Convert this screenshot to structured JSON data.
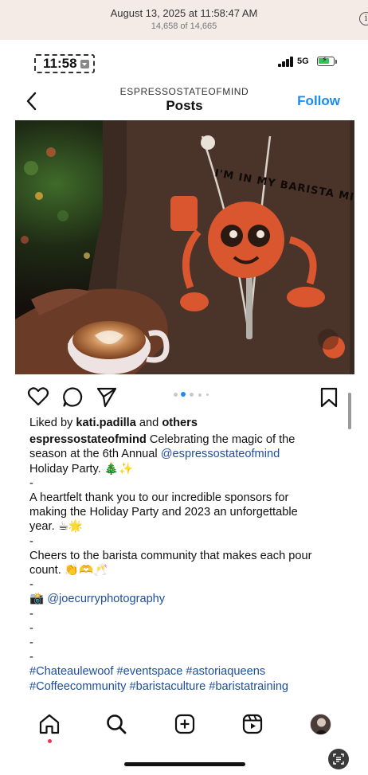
{
  "viewer": {
    "date": "August 13, 2025 at 11:58:47 AM",
    "count": "14,658 of 14,665",
    "info_icon": "info-icon"
  },
  "status_bar": {
    "time": "11:58",
    "network": "5G",
    "battery_icon": "battery-charging-icon",
    "battery_color": "#39c25a"
  },
  "header": {
    "account": "ESPRESSOSTATEOFMIND",
    "title": "Posts",
    "follow_label": "Follow",
    "follow_color": "#1a8cf0"
  },
  "post": {
    "carousel_dots": 5,
    "active_dot": 1,
    "liked_prefix": "Liked by ",
    "liked_user": "kati.padilla",
    "liked_mid": " and ",
    "liked_suffix": "others",
    "caption": {
      "username": "espressostateofmind",
      "l1_text": " Celebrating the magic of the",
      "l2_text": "season at the 6th Annual ",
      "l2_mention": "@espressostateofmind",
      "l3_text": "Holiday Party. 🎄✨",
      "dash": "-",
      "l5": "A heartfelt thank you to our incredible sponsors for",
      "l6": "making the Holiday Party and 2023 an unforgettable",
      "l7": "year. ☕🌟",
      "l9": "Cheers to the barista community that makes each pour",
      "l10": "count. 👏🫶🥂",
      "l12_icon": "📸",
      "l12_mention": "@joecurryphotography",
      "h1": "#Chateaulewoof",
      "h2": "#eventspace",
      "h3": "#astoriaqueens",
      "h4": "#Coffeecommunity",
      "h5": "#baristaculture",
      "h6": "#baristatraining"
    },
    "shirt_text": "I'M IN MY BARISTA MILK ERA"
  },
  "nav": {
    "items": [
      "home-icon",
      "search-icon",
      "create-icon",
      "reels-icon",
      "profile-avatar"
    ],
    "active": "home-icon",
    "notification_color": "#f0334f"
  }
}
